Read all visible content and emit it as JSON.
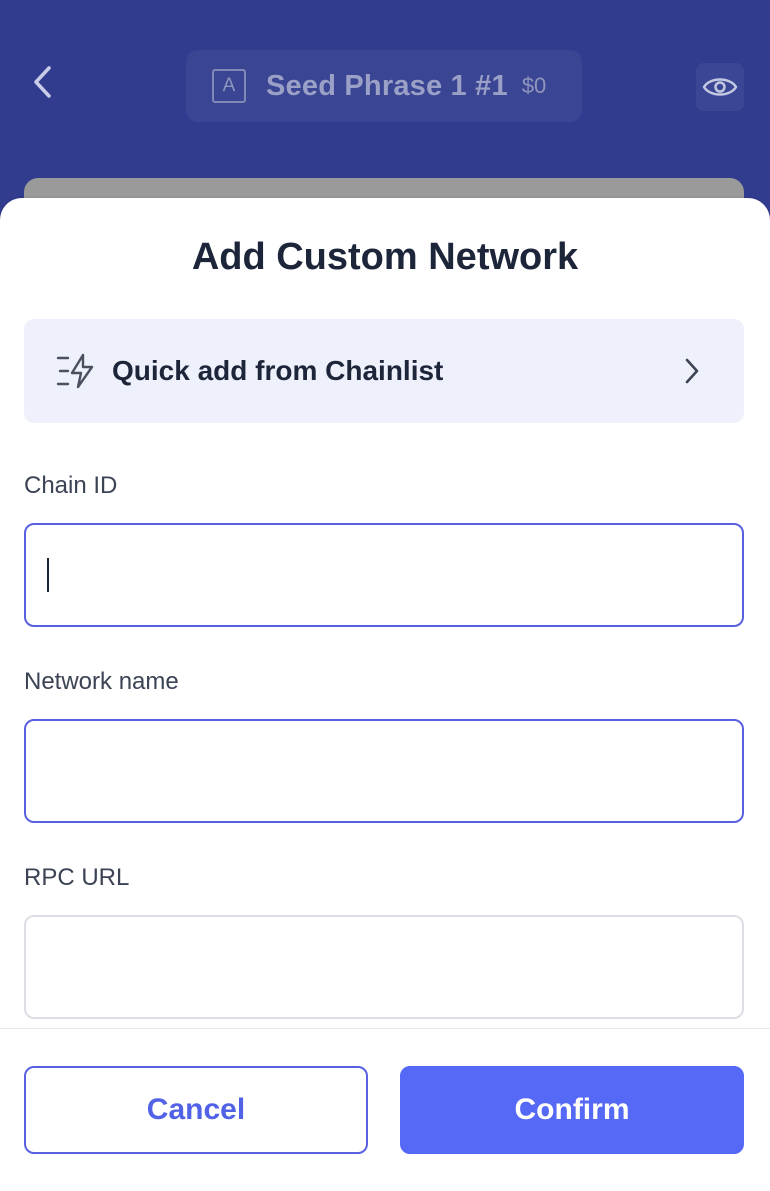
{
  "header": {
    "account_badge": "A",
    "account_name": "Seed Phrase 1 #1",
    "account_balance": "$0"
  },
  "sheet": {
    "title": "Add Custom Network",
    "quick_add_label": "Quick add from Chainlist"
  },
  "form": {
    "chain_id": {
      "label": "Chain ID",
      "value": "",
      "placeholder": ""
    },
    "network_name": {
      "label": "Network name",
      "value": "",
      "placeholder": ""
    },
    "rpc_url": {
      "label": "RPC URL",
      "value": "",
      "placeholder": ""
    }
  },
  "footer": {
    "cancel_label": "Cancel",
    "confirm_label": "Confirm"
  },
  "colors": {
    "header_bg": "#313c8f",
    "accent": "#5568f6",
    "quick_add_bg": "#eef0fb"
  },
  "icons": {
    "back": "chevron-left-icon",
    "visibility": "eye-icon",
    "quick_add": "lightning-list-icon",
    "row_chevron": "chevron-right-icon"
  }
}
